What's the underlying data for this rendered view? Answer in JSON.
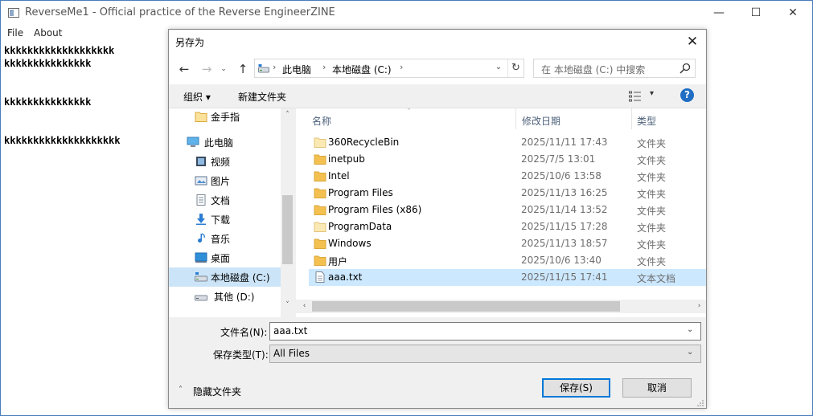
{
  "app": {
    "title": "ReverseMe1 - Official practice of the Reverse EngineerZINE",
    "minimize": "—",
    "maximize": "☐",
    "close": "✕",
    "menu": [
      "File",
      "About"
    ],
    "content_lines": [
      "kkkkkkkkkkkkkkkkkkk",
      "kkkkkkkkkkkkkkk",
      "kkkkkkkkkkkkkkk",
      "kkkkkkkkkkkkkkkkkkkk"
    ]
  },
  "dialog": {
    "title": "另存为",
    "close": "✕",
    "nav": {
      "back": "←",
      "forward": "→",
      "recent": "⌄",
      "up": "↑"
    },
    "address": {
      "segments": [
        "此电脑",
        "本地磁盘 (C:)"
      ],
      "chevron": "›",
      "dropdown": "⌄",
      "refresh": "↻"
    },
    "search_placeholder": "在 本地磁盘 (C:) 中搜索",
    "toolbar": {
      "organize": "组织 ▾",
      "new_folder": "新建文件夹",
      "view_arrow": "▾",
      "help": "?"
    },
    "nav_items": [
      {
        "label": "金手指",
        "icon": "folder-icon",
        "selected": false
      },
      {
        "label": "此电脑",
        "icon": "computer-icon",
        "selected": false
      },
      {
        "label": "视频",
        "icon": "video-icon",
        "selected": false
      },
      {
        "label": "图片",
        "icon": "pictures-icon",
        "selected": false
      },
      {
        "label": "文档",
        "icon": "documents-icon",
        "selected": false
      },
      {
        "label": "下载",
        "icon": "download-icon",
        "selected": false
      },
      {
        "label": "音乐",
        "icon": "music-icon",
        "selected": false
      },
      {
        "label": "桌面",
        "icon": "desktop-icon",
        "selected": false
      },
      {
        "label": "本地磁盘 (C:)",
        "icon": "drive-icon",
        "selected": true
      },
      {
        "label": "其他 (D:)",
        "icon": "drive-icon",
        "selected": false
      }
    ],
    "columns": {
      "name": "名称",
      "date": "修改日期",
      "type": "类型",
      "sort_arrow": "˄"
    },
    "files": [
      {
        "name": "360RecycleBin",
        "date": "2025/11/11 17:43",
        "type": "文件夹",
        "icon": "folder-pale-icon",
        "selected": false
      },
      {
        "name": "inetpub",
        "date": "2025/7/5 13:01",
        "type": "文件夹",
        "icon": "folder-icon",
        "selected": false
      },
      {
        "name": "Intel",
        "date": "2025/10/6 13:58",
        "type": "文件夹",
        "icon": "folder-icon",
        "selected": false
      },
      {
        "name": "Program Files",
        "date": "2025/11/13 16:25",
        "type": "文件夹",
        "icon": "folder-icon",
        "selected": false
      },
      {
        "name": "Program Files (x86)",
        "date": "2025/11/14 13:52",
        "type": "文件夹",
        "icon": "folder-icon",
        "selected": false
      },
      {
        "name": "ProgramData",
        "date": "2025/11/15 17:28",
        "type": "文件夹",
        "icon": "folder-pale-icon",
        "selected": false
      },
      {
        "name": "Windows",
        "date": "2025/11/13 18:57",
        "type": "文件夹",
        "icon": "folder-icon",
        "selected": false
      },
      {
        "name": "用户",
        "date": "2025/10/6 13:40",
        "type": "文件夹",
        "icon": "folder-icon",
        "selected": false
      },
      {
        "name": "aaa.txt",
        "date": "2025/11/15 17:41",
        "type": "文本文档",
        "icon": "text-file-icon",
        "selected": true
      }
    ],
    "scroll": {
      "up": "˄",
      "down": "˅",
      "left": "‹",
      "right": "›"
    },
    "filename_label": "文件名(N):",
    "filename_value": "aaa.txt",
    "filetype_label": "保存类型(T):",
    "filetype_value": "All Files",
    "combo_arrow": "⌄",
    "hide_folders": "隐藏文件夹",
    "hide_folders_icon": "˄",
    "save_button": "保存(S)",
    "cancel_button": "取消"
  },
  "colors": {
    "selection": "#cce8ff",
    "nav_selection": "#cce4f7",
    "accent": "#0078d7",
    "folder": "#f4c04f",
    "folder_pale": "#fbe9b4"
  }
}
